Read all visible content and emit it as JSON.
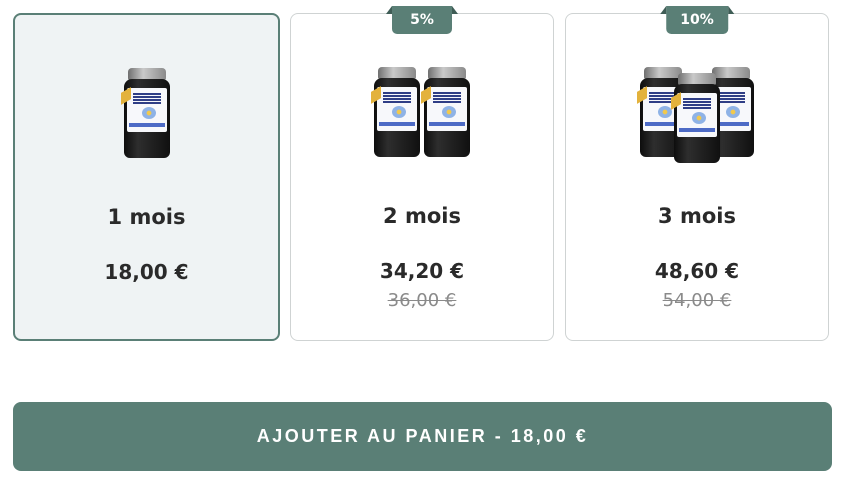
{
  "offers": [
    {
      "duration": "1 mois",
      "price": "18,00 €",
      "old_price": "",
      "badge": "",
      "selected": true,
      "image_icon": "product-jar-1-icon"
    },
    {
      "duration": "2 mois",
      "price": "34,20 €",
      "old_price": "36,00 €",
      "badge": "5%",
      "selected": false,
      "image_icon": "product-jar-2-icon"
    },
    {
      "duration": "3 mois",
      "price": "48,60 €",
      "old_price": "54,00 €",
      "badge": "10%",
      "selected": false,
      "image_icon": "product-jar-3-icon"
    }
  ],
  "cart_button": {
    "label": "AJOUTER AU PANIER - 18,00 €"
  },
  "colors": {
    "accent": "#5a7f76",
    "selected_bg": "#eff3f4",
    "card_border": "#cfd3d3",
    "old_price": "#8a8a8a"
  }
}
